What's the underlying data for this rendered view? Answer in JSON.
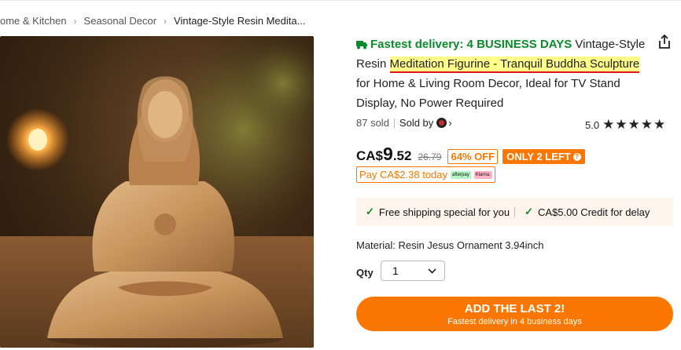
{
  "breadcrumb": {
    "items": [
      "ome & Kitchen",
      "Seasonal Decor",
      "Vintage-Style Resin Medita..."
    ]
  },
  "product": {
    "image_alt": "Resin figurine of Jesus seated in meditation on a table",
    "delivery_label": "Fastest delivery: 4 BUSINESS DAYS",
    "title_before": "Vintage-Style Resin",
    "title_highlight": "Meditation Figurine - Tranquil Buddha Sculpture",
    "title_after": "for Home & Living Room Decor, Ideal for TV Stand Display, No Power Required",
    "sold": "87 sold",
    "sold_by": "Sold by",
    "rating": "5.0",
    "stars": "★★★★★"
  },
  "price": {
    "currency": "CA$",
    "whole": "9",
    "cents": ".52",
    "original": "26.79",
    "discount": "64% OFF",
    "stock": "ONLY 2 LEFT",
    "pay_today": "Pay CA$2.38 today",
    "pay_badge_1": "afterpay",
    "pay_badge_2": "Klarna."
  },
  "promo": {
    "item1": "Free shipping special for you",
    "item2": "CA$5.00 Credit for delay"
  },
  "material": "Material: Resin Jesus Ornament 3.94inch",
  "qty": {
    "label": "Qty",
    "value": "1"
  },
  "cta": {
    "label": "ADD THE LAST 2!",
    "sub": "Fastest delivery in 4 business days"
  },
  "colors": {
    "accent": "#fb7701",
    "delivery_green": "#0a8a2a",
    "highlight": "#ffff8a",
    "underline_red": "#e01616"
  }
}
